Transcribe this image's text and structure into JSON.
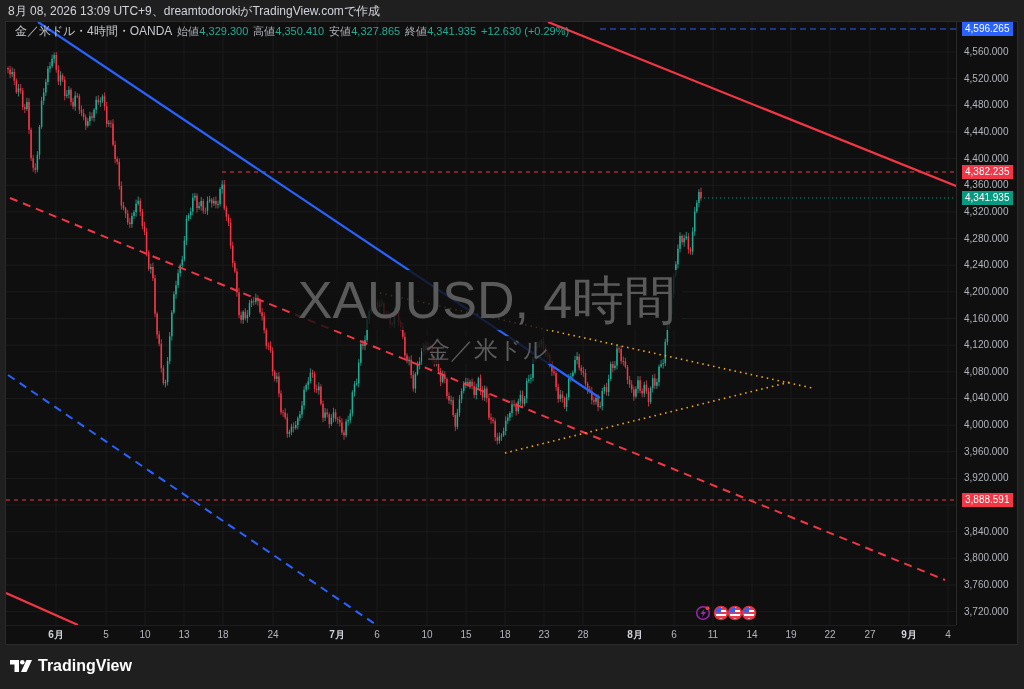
{
  "header": {
    "caption": "8月 08, 2026 13:09 UTC+9、dreamtodorokiがTradingView.comで作成"
  },
  "chart": {
    "legend": {
      "symbol": "金／米ドル・4時間・OANDA",
      "ohlc": [
        {
          "label": "始値",
          "value": "4,329.300"
        },
        {
          "label": "高値",
          "value": "4,350.410"
        },
        {
          "label": "安値",
          "value": "4,327.865"
        },
        {
          "label": "終値",
          "value": "4,341.935"
        }
      ],
      "change": "+12.630 (+0.29%)"
    },
    "watermark": {
      "title": "XAUUSD, 4時間",
      "subtitle": "金／米ドル"
    },
    "price_axis": {
      "ticks": [
        "4,560.000",
        "4,520.000",
        "4,480.000",
        "4,440.000",
        "4,400.000",
        "4,360.000",
        "4,320.000",
        "4,280.000",
        "4,240.000",
        "4,200.000",
        "4,160.000",
        "4,120.000",
        "4,080.000",
        "4,040.000",
        "4,000.000",
        "3,960.000",
        "3,920.000",
        "3,840.000",
        "3,800.000",
        "3,760.000",
        "3,720.000"
      ],
      "markers": [
        {
          "label": "4,596.265",
          "color": "#2962ff"
        },
        {
          "label": "4,382.235",
          "color": "#f23645"
        },
        {
          "label": "4,341.935",
          "color": "#089981"
        },
        {
          "label": "3,888.591",
          "color": "#f23645"
        }
      ]
    },
    "time_axis": {
      "ticks": [
        {
          "label": "6月",
          "kind": "month"
        },
        {
          "label": "5",
          "kind": "day"
        },
        {
          "label": "10",
          "kind": "day"
        },
        {
          "label": "13",
          "kind": "day"
        },
        {
          "label": "18",
          "kind": "day"
        },
        {
          "label": "24",
          "kind": "day"
        },
        {
          "label": "7月",
          "kind": "month"
        },
        {
          "label": "6",
          "kind": "day"
        },
        {
          "label": "10",
          "kind": "day"
        },
        {
          "label": "15",
          "kind": "day"
        },
        {
          "label": "18",
          "kind": "day"
        },
        {
          "label": "23",
          "kind": "day"
        },
        {
          "label": "28",
          "kind": "day"
        },
        {
          "label": "8月",
          "kind": "month"
        },
        {
          "label": "6",
          "kind": "day"
        },
        {
          "label": "11",
          "kind": "day"
        },
        {
          "label": "14",
          "kind": "day"
        },
        {
          "label": "19",
          "kind": "day"
        },
        {
          "label": "22",
          "kind": "day"
        },
        {
          "label": "27",
          "kind": "day"
        },
        {
          "label": "9月",
          "kind": "month"
        },
        {
          "label": "4",
          "kind": "day"
        }
      ]
    }
  },
  "footer": {
    "brand": "TradingView"
  }
}
